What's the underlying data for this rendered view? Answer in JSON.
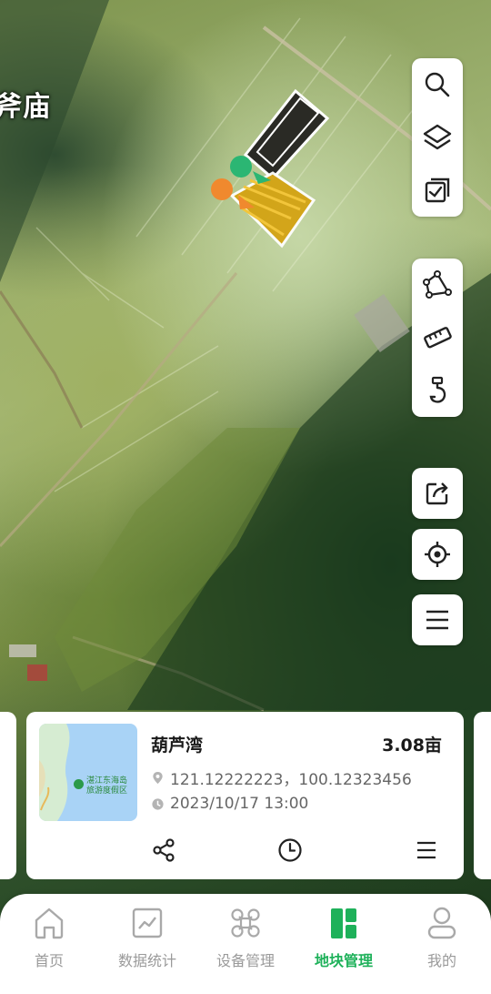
{
  "map": {
    "place_label": "斧庙"
  },
  "toolbar": {
    "group_top": [
      {
        "name": "search-icon"
      },
      {
        "name": "layers-icon"
      },
      {
        "name": "checklist-icon"
      }
    ],
    "group_middle": [
      {
        "name": "polygon-draw-icon"
      },
      {
        "name": "ruler-icon"
      },
      {
        "name": "hook-icon"
      }
    ],
    "export": {
      "name": "export-icon"
    },
    "locate": {
      "name": "crosshair-icon"
    },
    "menu": {
      "name": "menu-icon"
    }
  },
  "field_card": {
    "name": "葫芦湾",
    "area": "3.08亩",
    "coordinates": "121.12222223，100.12323456",
    "datetime": "2023/10/17 13:00",
    "thumbnail_poi": {
      "line1": "湛江东海岛",
      "line2": "旅游度假区"
    },
    "actions": [
      {
        "name": "share-icon"
      },
      {
        "name": "clock-icon"
      },
      {
        "name": "menu-icon"
      }
    ]
  },
  "bottom_nav": {
    "items": [
      {
        "label": "首页",
        "icon": "home-icon",
        "active": false
      },
      {
        "label": "数据统计",
        "icon": "chart-icon",
        "active": false
      },
      {
        "label": "设备管理",
        "icon": "drone-icon",
        "active": false
      },
      {
        "label": "地块管理",
        "icon": "field-block-icon",
        "active": true
      },
      {
        "label": "我的",
        "icon": "user-icon",
        "active": false
      }
    ],
    "active_color": "#1eb15a",
    "inactive_color": "#9a9a9a"
  }
}
